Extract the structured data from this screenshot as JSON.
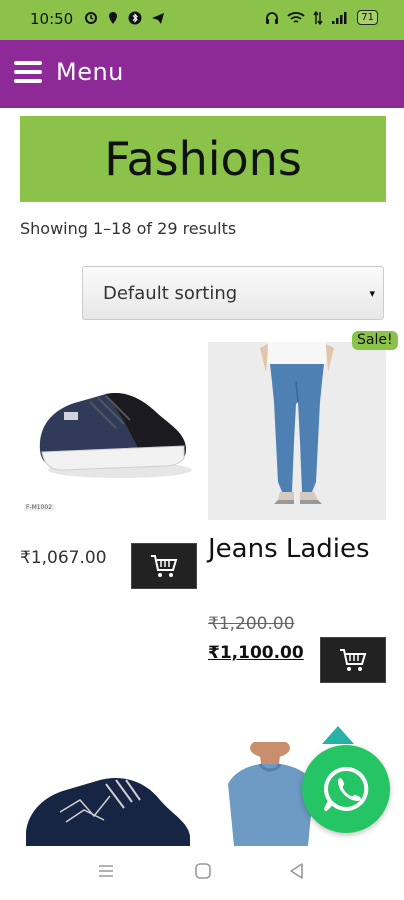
{
  "status": {
    "time": "10:50",
    "battery": "71"
  },
  "header": {
    "menu_label": "Menu"
  },
  "category": {
    "title": "Fashions"
  },
  "listing": {
    "results_text": "Showing 1–18 of 29 results",
    "sort_label": "Default sorting",
    "sort_caret": "▾"
  },
  "products": [
    {
      "price": "₹1,067.00",
      "image_tag": "F-M1002"
    },
    {
      "sale_badge": "Sale!",
      "name": "Jeans Ladies",
      "old_price": "₹1,200.00",
      "new_price": "₹1,100.00"
    }
  ],
  "colors": {
    "topbar": "#8e2a97",
    "accent_green": "#8bc34a",
    "whatsapp": "#25c464"
  },
  "icons": [
    "hamburger-icon",
    "cart-icon",
    "whatsapp-icon",
    "nav-recents-icon",
    "nav-home-icon",
    "nav-back-icon"
  ]
}
